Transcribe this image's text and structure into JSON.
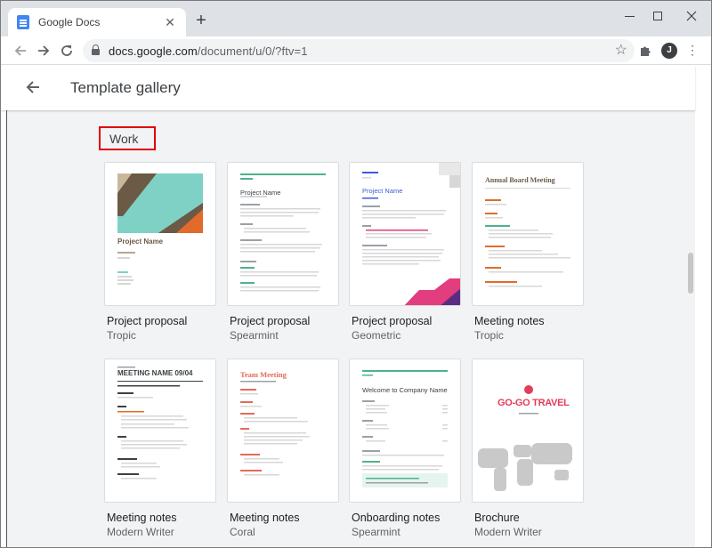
{
  "browser": {
    "tab_title": "Google Docs",
    "tab_close": "✕",
    "new_tab": "+",
    "url_host": "docs.google.com",
    "url_path": "/document/u/0/?ftv=1",
    "avatar_initial": "J"
  },
  "header": {
    "title": "Template gallery"
  },
  "section": {
    "label": "Work"
  },
  "templates": [
    {
      "name": "Project proposal",
      "style": "Tropic",
      "thumb_title": "Project Name"
    },
    {
      "name": "Project proposal",
      "style": "Spearmint",
      "thumb_title": "Project Name"
    },
    {
      "name": "Project proposal",
      "style": "Geometric",
      "thumb_title": "Project Name"
    },
    {
      "name": "Meeting notes",
      "style": "Tropic",
      "thumb_title": "Annual Board Meeting"
    },
    {
      "name": "Meeting notes",
      "style": "Modern Writer",
      "thumb_title": "MEETING NAME 09/04"
    },
    {
      "name": "Meeting notes",
      "style": "Coral",
      "thumb_title": "Team Meeting"
    },
    {
      "name": "Onboarding notes",
      "style": "Spearmint",
      "thumb_title": "Welcome to Company Name"
    },
    {
      "name": "Brochure",
      "style": "Modern Writer",
      "thumb_title": "GO-GO TRAVEL"
    }
  ],
  "colors": {
    "highlight_box": "#e00000",
    "tropic_teal": "#7fd1c6",
    "tropic_brown": "#6b5a45",
    "spearmint_green": "#4cb38c",
    "geometric_blue": "#3b5bdb",
    "geometric_pink": "#e23d7e",
    "coral_red": "#e46a5a",
    "tropic_orange": "#e26b2b"
  }
}
